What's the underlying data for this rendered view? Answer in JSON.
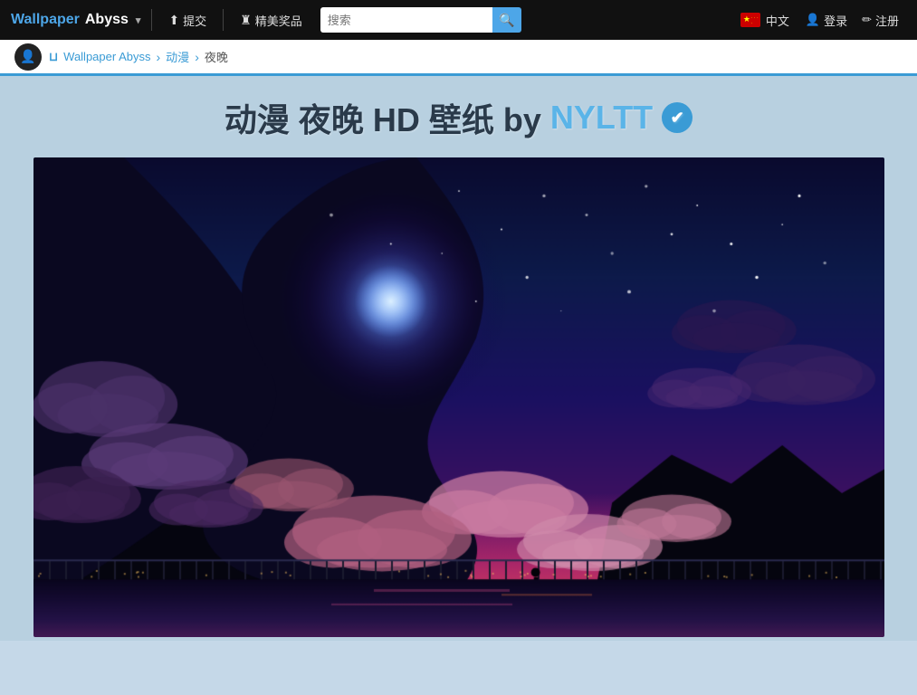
{
  "topNav": {
    "brandWallpaper": "Wallpaper",
    "brandAbyss": "Abyss",
    "caretIcon": "▾",
    "uploadBtn": "提交",
    "uploadIcon": "⬆",
    "awardsBtn": "精美奖品",
    "awardsIcon": "♜",
    "searchPlaceholder": "搜索",
    "searchIcon": "🔍",
    "flagLang": "中文",
    "loginIcon": "👤",
    "loginBtn": "登录",
    "registerIcon": "✏",
    "registerBtn": "注册"
  },
  "breadcrumb": {
    "homeIcon": "👤",
    "siteLabel": "Wallpaper Abyss",
    "wbIcon": "⊔",
    "sep1": "›",
    "cat1": "动漫",
    "sep2": "›",
    "cat2": "夜晚"
  },
  "pageTitle": {
    "titleMain": "动漫 夜晚 HD 壁纸 by",
    "titleBy": "NYLTT",
    "verifiedTitle": "verified"
  },
  "colors": {
    "accent": "#3a9bd5",
    "brand": "#4da6e8",
    "navBg": "#111111",
    "breadcrumbBg": "#ffffff",
    "pageBg": "#b8d0e0"
  }
}
